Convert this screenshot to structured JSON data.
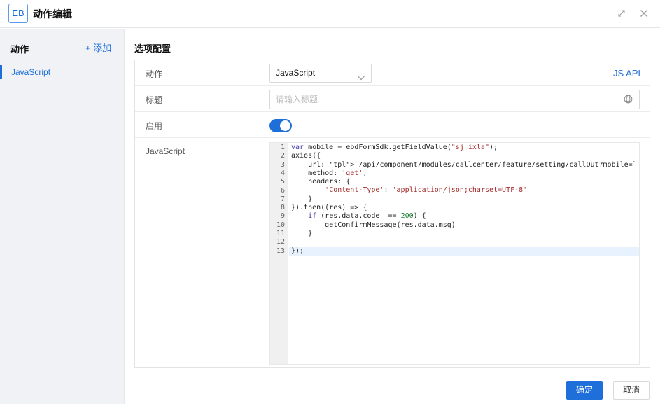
{
  "window": {
    "logo_text": "EB",
    "title": "动作编辑",
    "controls": [
      "expand-icon",
      "close-icon"
    ]
  },
  "sidebar": {
    "title": "动作",
    "add_label": "+ 添加",
    "items": [
      {
        "label": "JavaScript",
        "selected": true
      }
    ]
  },
  "main": {
    "section_title": "选项配置",
    "rows": {
      "action": {
        "label": "动作",
        "value": "JavaScript",
        "link": "JS API"
      },
      "title": {
        "label": "标题",
        "placeholder": "请输入标题",
        "value": ""
      },
      "enabled": {
        "label": "启用",
        "on": true
      },
      "script": {
        "label": "JavaScript"
      }
    },
    "code_lines": [
      "var mobile = ebdFormSdk.getFieldValue(\"sj_ixla\");",
      "axios({",
      "    url: `/api/component/modules/callcenter/feature/setting/callOut?mobile=` + mobile,",
      "    method: 'get',",
      "    headers: {",
      "        'Content-Type': 'application/json;charset=UTF-8'",
      "    }",
      "}).then((res) => {",
      "    if (res.data.code !== 200) {",
      "        getConfirmMessage(res.data.msg)",
      "    }",
      "",
      "});"
    ],
    "active_line": 13
  },
  "footer": {
    "ok_label": "确定",
    "cancel_label": "取消"
  },
  "colors": {
    "accent": "#1e6fd9",
    "sidebar_bg": "#f1f2f5"
  }
}
